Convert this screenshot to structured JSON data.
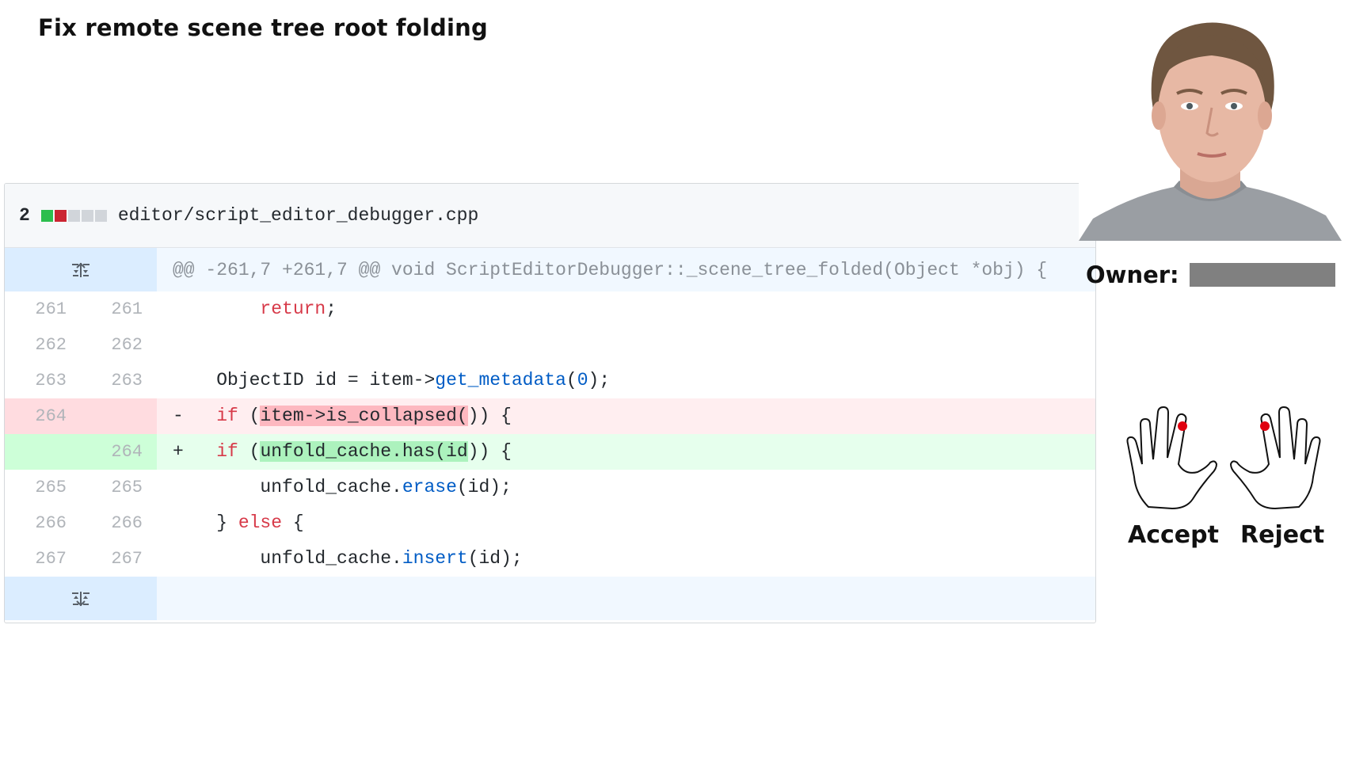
{
  "title": "Fix remote scene tree root folding",
  "file": {
    "change_count": "2",
    "path": "editor/script_editor_debugger.cpp",
    "diffstat": [
      "add",
      "del",
      "neutral",
      "neutral",
      "neutral"
    ]
  },
  "hunk_header": "@@ -261,7 +261,7 @@ void ScriptEditorDebugger::_scene_tree_folded(Object *obj) {",
  "lines": [
    {
      "old": "261",
      "new": "261",
      "type": "context",
      "marker": "",
      "segments": [
        {
          "t": "\t\t",
          "c": ""
        },
        {
          "t": "return",
          "c": "kw"
        },
        {
          "t": ";",
          "c": ""
        }
      ]
    },
    {
      "old": "262",
      "new": "262",
      "type": "context",
      "marker": "",
      "segments": [
        {
          "t": "",
          "c": ""
        }
      ]
    },
    {
      "old": "263",
      "new": "263",
      "type": "context",
      "marker": "",
      "segments": [
        {
          "t": "\tObjectID id = item->",
          "c": ""
        },
        {
          "t": "get_metadata",
          "c": "fn"
        },
        {
          "t": "(",
          "c": ""
        },
        {
          "t": "0",
          "c": "numlit"
        },
        {
          "t": ");",
          "c": ""
        }
      ]
    },
    {
      "old": "264",
      "new": "",
      "type": "del",
      "marker": "-",
      "segments": [
        {
          "t": "\t",
          "c": ""
        },
        {
          "t": "if",
          "c": "kw"
        },
        {
          "t": " (",
          "c": ""
        },
        {
          "t": "item->is_collapsed(",
          "c": "del-hl"
        },
        {
          "t": ")) {",
          "c": ""
        }
      ]
    },
    {
      "old": "",
      "new": "264",
      "type": "add",
      "marker": "+",
      "segments": [
        {
          "t": "\t",
          "c": ""
        },
        {
          "t": "if",
          "c": "kw"
        },
        {
          "t": " (",
          "c": ""
        },
        {
          "t": "unfold_cache.has(id",
          "c": "add-hl"
        },
        {
          "t": ")) {",
          "c": ""
        }
      ]
    },
    {
      "old": "265",
      "new": "265",
      "type": "context",
      "marker": "",
      "segments": [
        {
          "t": "\t\tunfold_cache.",
          "c": ""
        },
        {
          "t": "erase",
          "c": "fn"
        },
        {
          "t": "(id);",
          "c": ""
        }
      ]
    },
    {
      "old": "266",
      "new": "266",
      "type": "context",
      "marker": "",
      "segments": [
        {
          "t": "\t} ",
          "c": ""
        },
        {
          "t": "else",
          "c": "kw"
        },
        {
          "t": " {",
          "c": ""
        }
      ]
    },
    {
      "old": "267",
      "new": "267",
      "type": "context",
      "marker": "",
      "segments": [
        {
          "t": "\t\tunfold_cache.",
          "c": ""
        },
        {
          "t": "insert",
          "c": "fn"
        },
        {
          "t": "(id);",
          "c": ""
        }
      ]
    }
  ],
  "owner": {
    "label": "Owner:"
  },
  "actions": {
    "accept_label": "Accept",
    "reject_label": "Reject"
  },
  "colors": {
    "deleted_bg": "#ffeef0",
    "added_bg": "#e6ffed",
    "hunk_bg": "#f1f8ff",
    "keyword": "#d73a49",
    "function": "#005cc5",
    "fingertip_dot": "#e0000f"
  },
  "icons": {
    "expand_up": "unfold-up-icon",
    "expand_down": "unfold-down-icon",
    "left_hand": "left-hand-icon",
    "right_hand": "right-hand-icon"
  }
}
